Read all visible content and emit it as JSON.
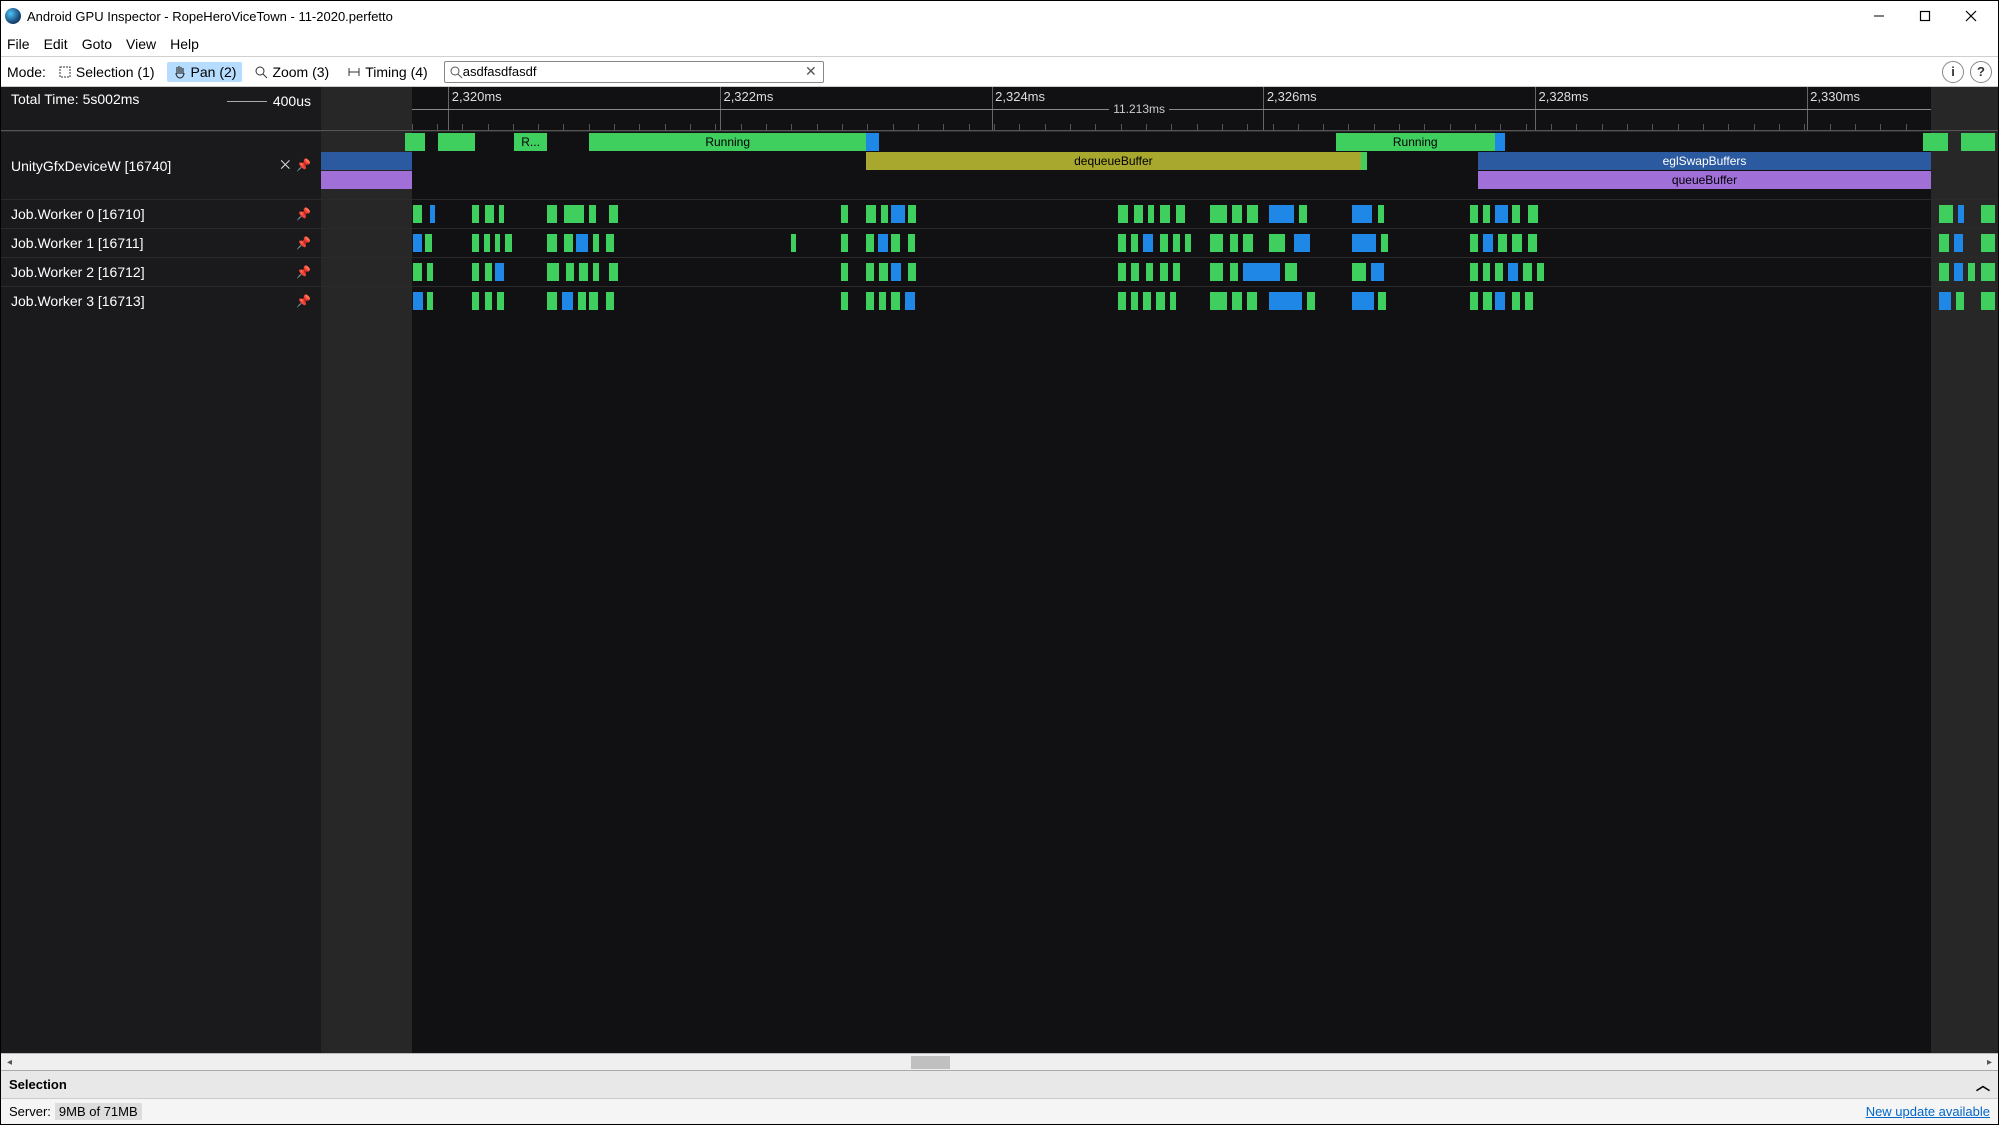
{
  "title": "Android GPU Inspector - RopeHeroViceTown - 11-2020.perfetto",
  "menu": {
    "file": "File",
    "edit": "Edit",
    "goto": "Goto",
    "view": "View",
    "help": "Help"
  },
  "toolbar": {
    "mode_label": "Mode:",
    "selection": "Selection (1)",
    "pan": "Pan (2)",
    "zoom": "Zoom (3)",
    "timing": "Timing (4)",
    "search_value": "asdfasdfasdf"
  },
  "ruler": {
    "total_time": "Total Time: 5s002ms",
    "scale": "400us",
    "range_label": "11.213ms",
    "ticks": [
      "2,320ms",
      "2,322ms",
      "2,324ms",
      "2,326ms",
      "2,328ms",
      "2,330ms"
    ]
  },
  "tracks": {
    "main": {
      "label": "UnityGfxDeviceW [16740]",
      "running1": "Running",
      "running2": "Running",
      "running_short": "R...",
      "dequeue": "dequeueBuffer",
      "eglswap": "eglSwapBuffers",
      "queue": "queueBuffer"
    },
    "workers": [
      {
        "label": "Job.Worker 0 [16710]"
      },
      {
        "label": "Job.Worker 1 [16711]"
      },
      {
        "label": "Job.Worker 2 [16712]"
      },
      {
        "label": "Job.Worker 3 [16713]"
      }
    ]
  },
  "selection_panel": "Selection",
  "status": {
    "server": "Server:",
    "mem": "9MB of 71MB",
    "update": "New update available"
  }
}
